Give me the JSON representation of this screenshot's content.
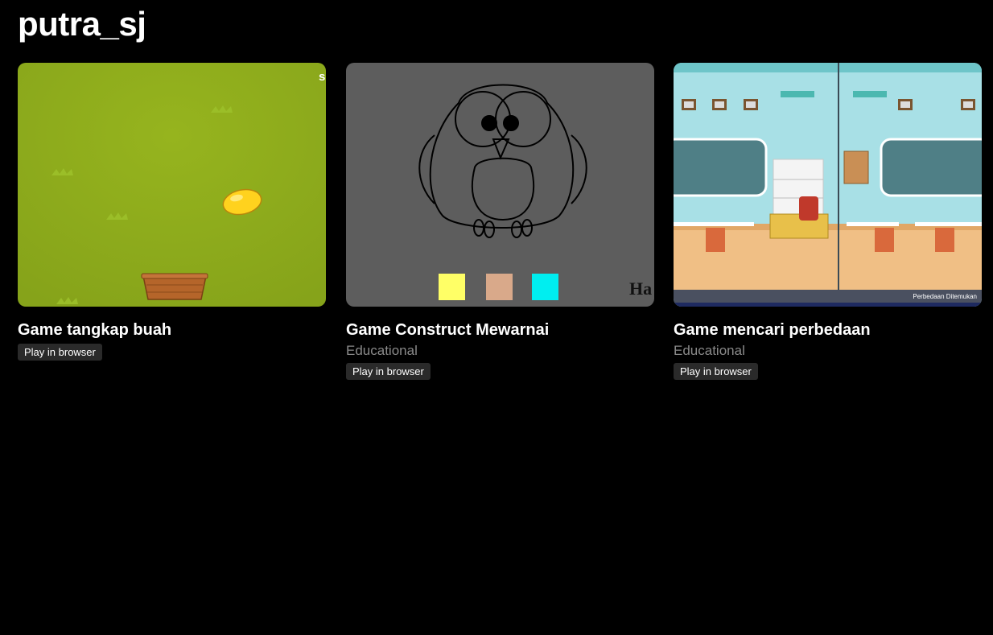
{
  "profile": {
    "name": "putra_sj"
  },
  "games": [
    {
      "title": "Game tangkap buah",
      "genre": "",
      "badge": "Play in browser",
      "thumb_overlay_text": "s"
    },
    {
      "title": "Game Construct Mewarnai",
      "genre": "Educational",
      "badge": "Play in browser",
      "thumb_overlay_text": "Ha",
      "palette": [
        "#ffff66",
        "#d9a98a",
        "#00eef0"
      ]
    },
    {
      "title": "Game mencari perbedaan",
      "genre": "Educational",
      "badge": "Play in browser",
      "thumb_overlay_text": "Perbedaan Ditemukan"
    }
  ]
}
